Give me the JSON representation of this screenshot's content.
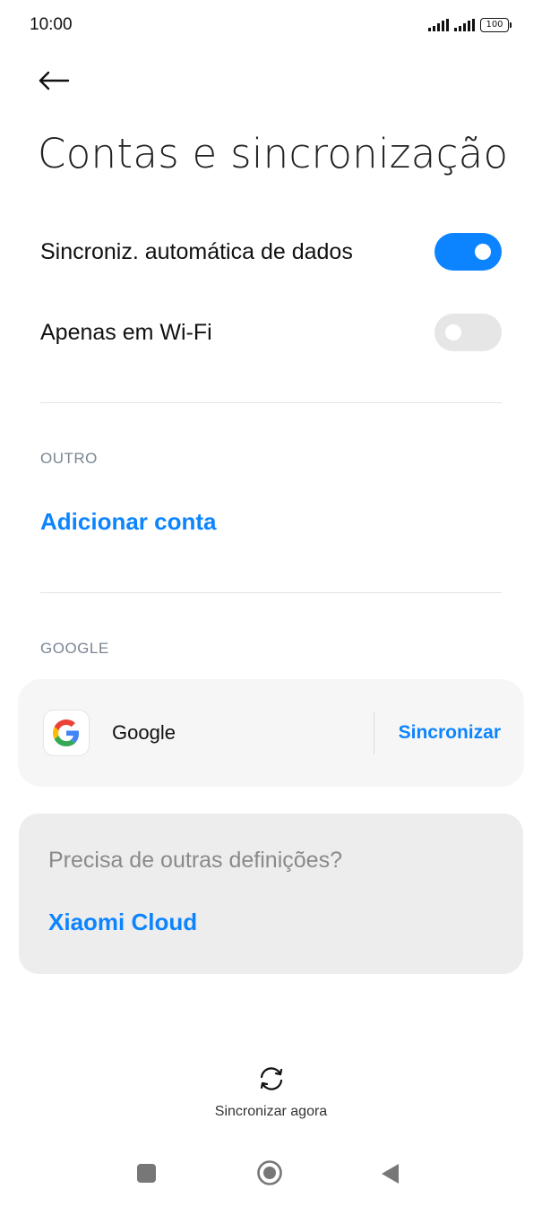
{
  "status_bar": {
    "time": "10:00",
    "battery": "100"
  },
  "header": {
    "back_icon": "arrow-left-icon",
    "title": "Contas e sincronização"
  },
  "settings": {
    "auto_sync": {
      "label": "Sincroniz. automática de dados",
      "enabled": true
    },
    "wifi_only": {
      "label": "Apenas em Wi-Fi",
      "enabled": false
    }
  },
  "sections": {
    "other": {
      "header": "OUTRO",
      "add_account": "Adicionar conta"
    },
    "google": {
      "header": "GOOGLE",
      "account_name": "Google",
      "sync_label": "Sincronizar"
    }
  },
  "help_card": {
    "text": "Precisa de outras definições?",
    "link": "Xiaomi Cloud"
  },
  "footer": {
    "sync_now": "Sincronizar agora",
    "sync_icon": "sync-icon"
  },
  "colors": {
    "accent": "#0d84ff",
    "toggle_off": "#e6e6e6",
    "card_bg": "#f6f6f6",
    "help_bg": "#ededed"
  }
}
